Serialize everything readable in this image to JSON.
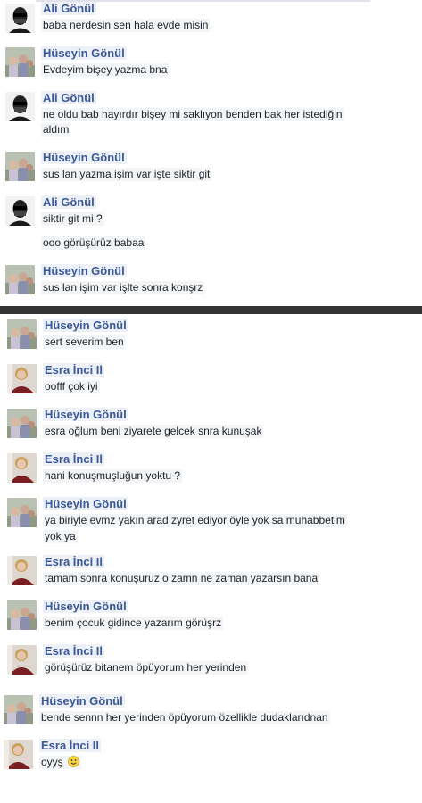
{
  "chat_one": {
    "messages": [
      {
        "sender": "Ali Gönül",
        "avatar": "man-sunglasses-avatar",
        "lines": [
          "baba nerdesin sen hala evde misin"
        ]
      },
      {
        "sender": "Hüseyin Gönül",
        "avatar": "group-photo-avatar",
        "lines": [
          "Evdeyim bişey yazma bna"
        ]
      },
      {
        "sender": "Ali Gönül",
        "avatar": "man-sunglasses-avatar",
        "lines": [
          "ne oldu bab hayırdır bişey mi saklıyon benden bak her istediğin",
          "aldım"
        ]
      },
      {
        "sender": "Hüseyin Gönül",
        "avatar": "group-photo-avatar",
        "lines": [
          "sus lan yazma işim var işte siktir git"
        ]
      },
      {
        "sender": "Ali Gönül",
        "avatar": "man-sunglasses-avatar",
        "lines": [
          "siktir git mi ?",
          "ooo görüşürüz babaa"
        ]
      },
      {
        "sender": "Hüseyin Gönül",
        "avatar": "group-photo-avatar",
        "lines": [
          "sus lan işim var işlte sonra konşrz"
        ]
      }
    ]
  },
  "chat_two": {
    "messages": [
      {
        "sender": "Hüseyin Gönül",
        "avatar": "group-photo-avatar",
        "lines": [
          "sert severim ben"
        ]
      },
      {
        "sender": "Esra İnci Il",
        "avatar": "woman-portrait-avatar",
        "lines": [
          "oofff çok iyi"
        ]
      },
      {
        "sender": "Hüseyin Gönül",
        "avatar": "group-photo-avatar",
        "lines": [
          "esra oğlum beni ziyarete gelcek snra kunuşak"
        ]
      },
      {
        "sender": "Esra İnci Il",
        "avatar": "woman-portrait-avatar",
        "lines": [
          "hani konuşmuşluğun yoktu ?"
        ]
      },
      {
        "sender": "Hüseyin Gönül",
        "avatar": "group-photo-avatar",
        "lines": [
          "ya biriyle evmz yakın arad zyret ediyor öyle yok sa muhabbetim",
          "yok ya"
        ]
      },
      {
        "sender": "Esra İnci Il",
        "avatar": "woman-portrait-avatar",
        "lines": [
          "tamam sonra konuşuruz o zamn ne zaman yazarsın bana"
        ]
      },
      {
        "sender": "Hüseyin Gönül",
        "avatar": "group-photo-avatar",
        "lines": [
          "benim çocuk gidince yazarım görüşrz"
        ]
      },
      {
        "sender": "Esra İnci Il",
        "avatar": "woman-portrait-avatar",
        "lines": [
          "görüşürüz bitanem öpüyorum her yerinden"
        ]
      },
      {
        "sender": "Hüseyin Gönül",
        "avatar": "group-photo-avatar",
        "lines": [
          "bende sennn her yerinden öpüyorum özellikle dudaklarıdnan"
        ]
      },
      {
        "sender": "Esra İnci Il",
        "avatar": "woman-portrait-avatar",
        "lines": [
          "oyyş"
        ],
        "emoji": "smiley-emoji"
      }
    ]
  }
}
